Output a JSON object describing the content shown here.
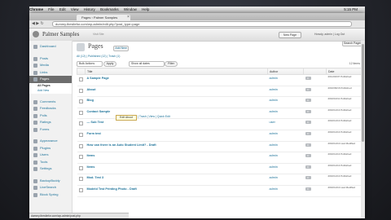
{
  "menubar": {
    "items": [
      "Chrome",
      "File",
      "Edit",
      "View",
      "History",
      "Bookmarks",
      "Window",
      "Help"
    ],
    "clock": "5:15 PM"
  },
  "browser": {
    "tab_title": "Pages ‹ Palmer Samples",
    "url": "dummy.thesitefor.com/wp-admin/edit.php?post_type=page"
  },
  "adminbar": {
    "site": "Palmer Samples",
    "visit": "Visit Site",
    "new_post": "New Page",
    "howdy": "Howdy, admin | Log Out"
  },
  "sidebar": {
    "group1": [
      {
        "label": "Dashboard",
        "name": "dashboard"
      }
    ],
    "group2": [
      {
        "label": "Posts",
        "name": "posts"
      },
      {
        "label": "Media",
        "name": "media"
      },
      {
        "label": "Links",
        "name": "links"
      },
      {
        "label": "Pages",
        "name": "pages",
        "active": true
      }
    ],
    "pages_sub": [
      "All Pages",
      "Add New"
    ],
    "group3": [
      {
        "label": "Comments",
        "name": "comments"
      },
      {
        "label": "Feedbacks",
        "name": "feedbacks"
      },
      {
        "label": "Polls",
        "name": "polls"
      },
      {
        "label": "Ratings",
        "name": "ratings"
      },
      {
        "label": "Forms",
        "name": "forms"
      }
    ],
    "group4": [
      {
        "label": "Appearance",
        "name": "appearance"
      },
      {
        "label": "Plugins",
        "name": "plugins"
      },
      {
        "label": "Users",
        "name": "users"
      },
      {
        "label": "Tools",
        "name": "tools"
      },
      {
        "label": "Settings",
        "name": "settings"
      }
    ],
    "group5": [
      {
        "label": "BackupBuddy",
        "name": "backupbuddy"
      },
      {
        "label": "LiveSearch",
        "name": "livesearch"
      },
      {
        "label": "Block Spring",
        "name": "block-spring"
      }
    ]
  },
  "page": {
    "title": "Pages",
    "add_new": "Add New",
    "search_button": "Search Pages",
    "subsub": "All (12) | Published (12) | Trash (1)",
    "bulk": "Bulk Actions",
    "apply": "Apply",
    "dates": "Show all dates",
    "filter": "Filter",
    "pagination": "12 items"
  },
  "table": {
    "headers": {
      "title": "Title",
      "author": "Author",
      "comments": "",
      "date": "Date"
    },
    "rows": [
      {
        "title": "A Sample Page",
        "author": "admin",
        "comments": "0",
        "date": "2011/02/07 Published"
      },
      {
        "title": "About",
        "author": "admin",
        "comments": "0",
        "date": "2010/09/16 Published"
      },
      {
        "title": "Blog",
        "author": "admin",
        "comments": "0",
        "date": "2010/10/11 Published"
      },
      {
        "title": "Contact Sample",
        "author": "admin",
        "comments": "0",
        "date": "2010/11/13 Published"
      },
      {
        "title": "— Sub Test",
        "author": "user",
        "comments": "0",
        "date": "2010/11/13 Published"
      },
      {
        "title": "Form test",
        "author": "admin",
        "comments": "0",
        "date": "2010/11/13 Published"
      },
      {
        "title": "How can there is an Auto Student Limit? - Draft",
        "author": "admin",
        "comments": "0",
        "date": "2010/11/13 Last Modified"
      },
      {
        "title": "Items",
        "author": "admin",
        "comments": "0",
        "date": "2010/11/13 Published"
      },
      {
        "title": "Items",
        "author": "admin",
        "comments": "0",
        "date": "2010/11/13 Published"
      },
      {
        "title": "Mod. Test 3",
        "author": "admin",
        "comments": "0",
        "date": "2010/11/13 Published"
      },
      {
        "title": "Modeld Test Printing Photo - Draft",
        "author": "admin",
        "comments": "0",
        "date": "2010/11/13 Last Modified"
      }
    ]
  },
  "hover": {
    "tip": "Edit About",
    "links": "| Trash | View | Quick Edit"
  },
  "statusbar": "dummy.thesitefor.com/wp-admin/post.php"
}
